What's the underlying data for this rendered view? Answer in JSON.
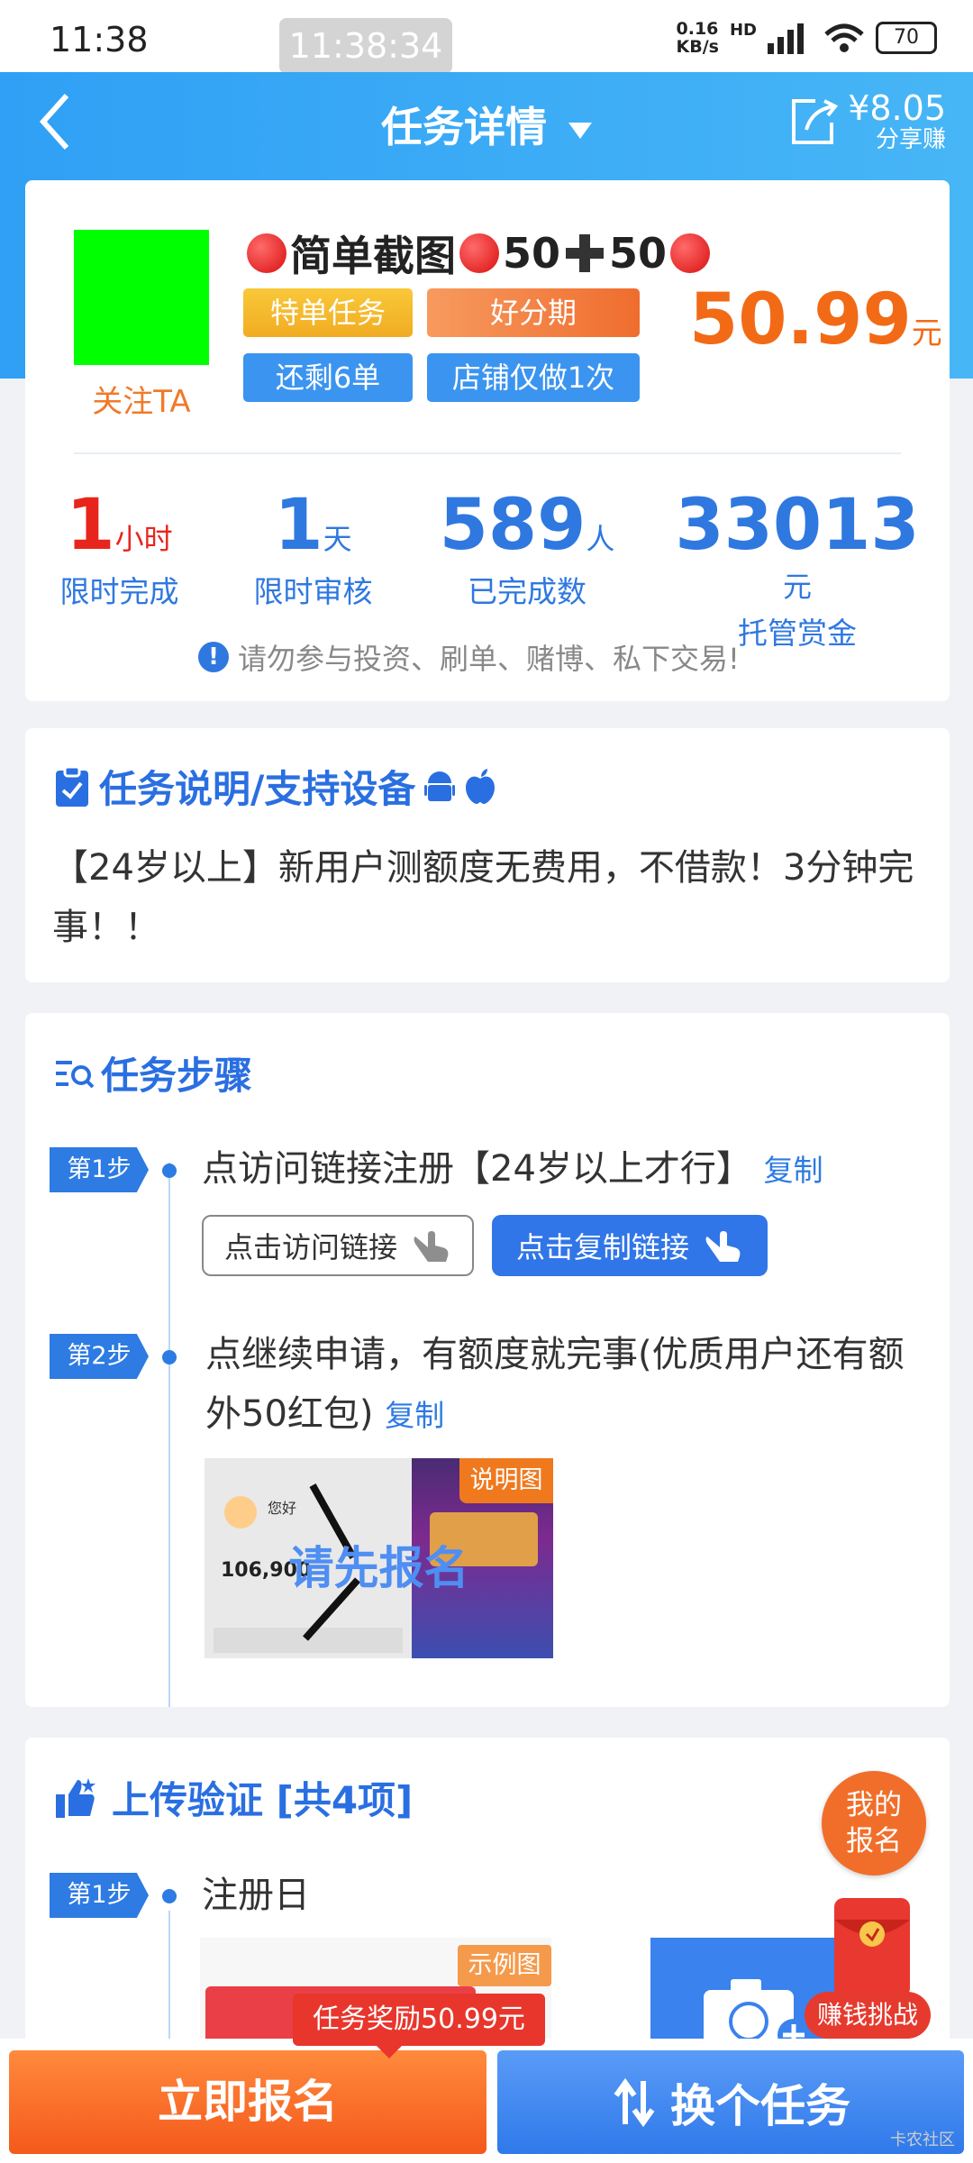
{
  "status_bar": {
    "time": "11:38",
    "screen_timer": "11:38:34",
    "net_speed_top": "0.16",
    "net_speed_bottom": "KB/s",
    "network": "HD",
    "battery": "70"
  },
  "nav": {
    "title": "任务详情",
    "share_amount": "¥8.05",
    "share_label": "分享赚"
  },
  "task": {
    "follow_label": "关注TA",
    "title_text1": "简单截图",
    "title_text2": "50",
    "title_text3": "50",
    "tags": [
      "特单任务",
      "好分期",
      "还剩6单",
      "店铺仅做1次"
    ],
    "price": "50.99",
    "price_unit": "元",
    "stats": [
      {
        "num": "1",
        "unit": "小时",
        "label": "限时完成"
      },
      {
        "num": "1",
        "unit": "天",
        "label": "限时审核"
      },
      {
        "num": "589",
        "unit": "人",
        "label": "已完成数"
      },
      {
        "num": "33013",
        "unit": "元",
        "label": "托管赏金"
      }
    ],
    "warning": "请勿参与投资、刷单、赌博、私下交易!"
  },
  "description": {
    "title": "任务说明/支持设备",
    "text": "【24岁以上】新用户测额度无费用，不借款！3分钟完事！！"
  },
  "steps_section": {
    "title": "任务步骤",
    "step1_badge": "第1步",
    "step1_text": "点访问链接注册【24岁以上才行】",
    "copy_label": "复制",
    "visit_button": "点击访问链接",
    "copy_link_button": "点击复制链接",
    "step2_badge": "第2步",
    "step2_text": "点继续申请，有额度就完事(优质用户还有额外50红包)",
    "image_tag": "说明图",
    "image_overlay": "请先报名",
    "thumb_greeting": "您好",
    "thumb_amount": "106,900"
  },
  "upload_section": {
    "title": "上传验证 [共4项]",
    "step1_badge": "第1步",
    "step1_text": "注册日",
    "example_tag": "示例图",
    "my_signup": "我的报名",
    "challenge": "赚钱挑战"
  },
  "bottom_bar": {
    "reward_tip": "任务奖励50.99元",
    "signup_button": "立即报名",
    "switch_button": "换个任务",
    "watermark": "卡农社区"
  },
  "colors": {
    "brand_blue": "#2f8df0",
    "accent_orange": "#f26a16",
    "tag_yellow": "#f7b830",
    "tag_blue": "#3b94f0"
  }
}
